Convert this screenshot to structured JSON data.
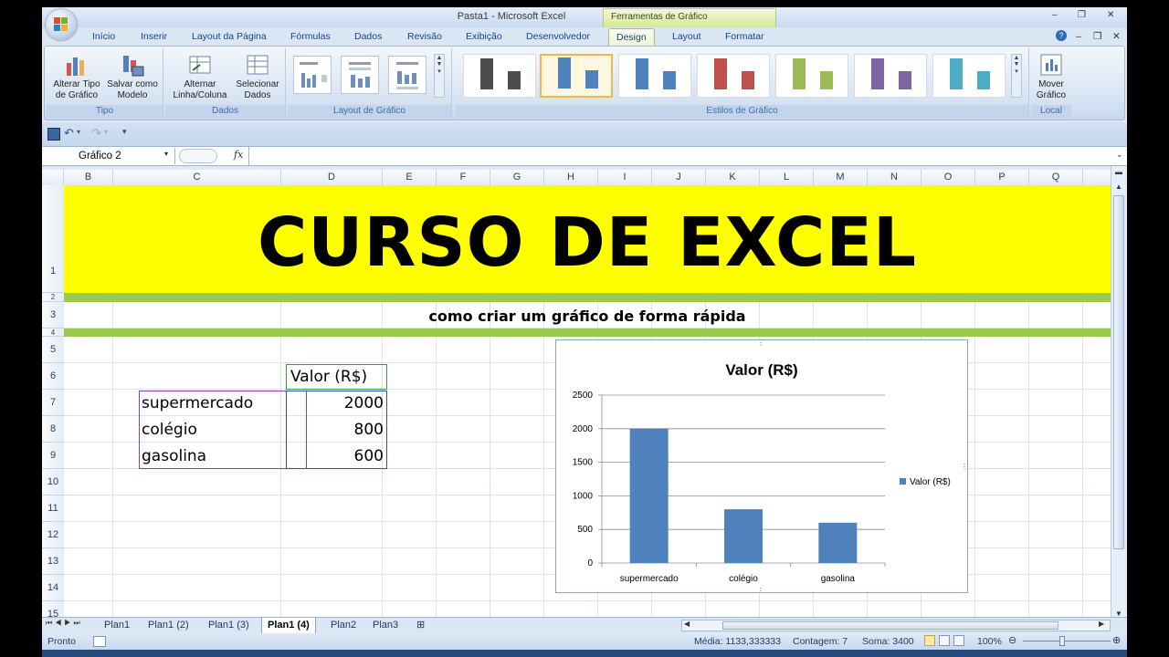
{
  "window": {
    "title": "Pasta1 - Microsoft Excel",
    "context_tab_title": "Ferramentas de Gráfico",
    "min": "–",
    "restore": "❐",
    "close": "✕"
  },
  "tabs": [
    "Início",
    "Inserir",
    "Layout da Página",
    "Fórmulas",
    "Dados",
    "Revisão",
    "Exibição",
    "Desenvolvedor",
    "Design",
    "Layout",
    "Formatar"
  ],
  "active_tab": "Design",
  "ribbon": {
    "tipo": {
      "label": "Tipo",
      "btn1": "Alterar Tipo de Gráfico",
      "btn2": "Salvar como Modelo"
    },
    "dados": {
      "label": "Dados",
      "btn1": "Alternar Linha/Coluna",
      "btn2": "Selecionar Dados"
    },
    "layout": {
      "label": "Layout de Gráfico"
    },
    "estilos": {
      "label": "Estilos de Gráfico",
      "colors": [
        "#4d4d4d",
        "#4f81bd",
        "#4f81bd",
        "#c0504d",
        "#9bbb59",
        "#8064a2",
        "#4bacc6"
      ]
    },
    "local": {
      "label": "Local",
      "btn1": "Mover Gráfico"
    }
  },
  "formula_bar": {
    "name_box": "Gráfico 2",
    "fx": "fx",
    "value": ""
  },
  "columns": [
    "B",
    "C",
    "D",
    "E",
    "F",
    "G",
    "H",
    "I",
    "J",
    "K",
    "L",
    "M",
    "N",
    "O",
    "P",
    "Q"
  ],
  "rows": [
    "1",
    "2",
    "3",
    "4",
    "5",
    "6",
    "7",
    "8",
    "9",
    "10",
    "11",
    "12",
    "13",
    "14",
    "15"
  ],
  "sheet": {
    "banner": "CURSO DE EXCEL",
    "subtitle": "como criar um gráfico de forma rápida",
    "header_value": "Valor (R$)",
    "items": [
      {
        "label": "supermercado",
        "value": "2000"
      },
      {
        "label": "colégio",
        "value": "800"
      },
      {
        "label": "gasolina",
        "value": "600"
      }
    ]
  },
  "chart_data": {
    "type": "bar",
    "title": "Valor (R$)",
    "categories": [
      "supermercado",
      "colégio",
      "gasolina"
    ],
    "series": [
      {
        "name": "Valor (R$)",
        "values": [
          2000,
          800,
          600
        ]
      }
    ],
    "ylim": [
      0,
      2500
    ],
    "yticks": [
      0,
      500,
      1000,
      1500,
      2000,
      2500
    ],
    "legend": "right",
    "grid": true,
    "color": "#4f81bd"
  },
  "sheet_tabs": [
    "Plan1",
    "Plan1 (2)",
    "Plan1 (3)",
    "Plan1 (4)",
    "Plan2",
    "Plan3"
  ],
  "active_sheet": "Plan1 (4)",
  "status": {
    "ready": "Pronto",
    "average": "Média: 1133,333333",
    "count": "Contagem: 7",
    "sum": "Soma: 3400",
    "zoom": "100%"
  }
}
